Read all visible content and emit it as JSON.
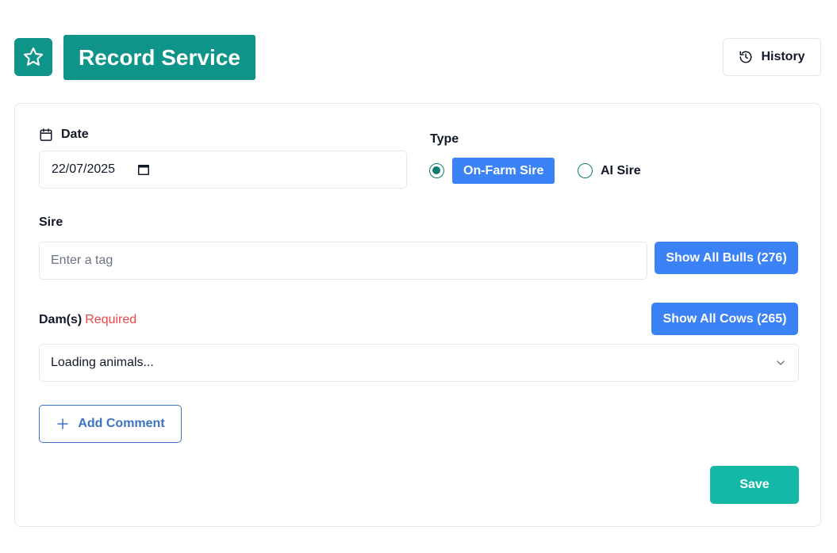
{
  "header": {
    "title": "Record Service",
    "logo_icon": "star-icon",
    "history_label": "History",
    "history_icon": "history-icon"
  },
  "form": {
    "date": {
      "label": "Date",
      "icon": "calendar-icon",
      "value": "22/07/2025"
    },
    "type": {
      "label": "Type",
      "options": [
        {
          "label": "On-Farm Sire",
          "selected": true
        },
        {
          "label": "AI Sire",
          "selected": false
        }
      ]
    },
    "sire": {
      "label": "Sire",
      "placeholder": "Enter a tag",
      "show_all_label": "Show All Bulls (276)"
    },
    "dams": {
      "label": "Dam(s)",
      "required_label": "Required",
      "show_all_label": "Show All Cows (265)",
      "select_value": "Loading animals..."
    },
    "add_comment_label": "Add Comment",
    "save_label": "Save"
  },
  "colors": {
    "primary_teal": "#0e9488",
    "save_teal": "#14b8a6",
    "accent_blue": "#3b82f6",
    "required_red": "#ef4444"
  }
}
